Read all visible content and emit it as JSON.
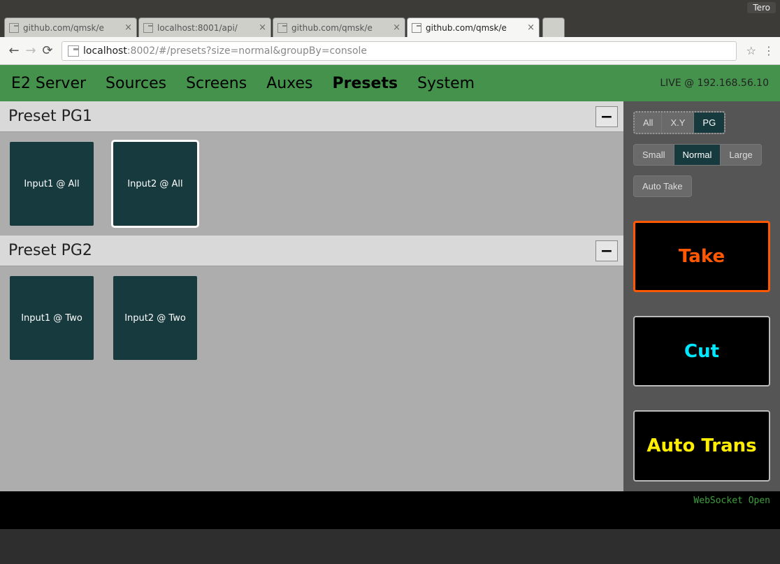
{
  "os": {
    "user": "Tero"
  },
  "browser": {
    "tabs": [
      {
        "label": "github.com/qmsk/e",
        "active": false
      },
      {
        "label": "localhost:8001/api/",
        "active": false
      },
      {
        "label": "github.com/qmsk/e",
        "active": false
      },
      {
        "label": "github.com/qmsk/e",
        "active": true
      }
    ],
    "address": {
      "scheme_host": "localhost",
      "port_path": ":8002/#/presets?size=normal&groupBy=console"
    }
  },
  "nav": {
    "brand": "E2 Server",
    "items": [
      {
        "label": "Sources",
        "active": false
      },
      {
        "label": "Screens",
        "active": false
      },
      {
        "label": "Auxes",
        "active": false
      },
      {
        "label": "Presets",
        "active": true
      },
      {
        "label": "System",
        "active": false
      }
    ],
    "status": "LIVE @ 192.168.56.10"
  },
  "groups": [
    {
      "title": "Preset PG1",
      "presets": [
        {
          "label": "Input1 @ All",
          "selected": false
        },
        {
          "label": "Input2 @ All",
          "selected": true
        }
      ]
    },
    {
      "title": "Preset PG2",
      "presets": [
        {
          "label": "Input1 @ Two",
          "selected": false
        },
        {
          "label": "Input2 @ Two",
          "selected": false
        }
      ]
    }
  ],
  "side": {
    "groupBy": [
      {
        "label": "All",
        "active": false
      },
      {
        "label": "X.Y",
        "active": false
      },
      {
        "label": "PG",
        "active": true
      }
    ],
    "size": [
      {
        "label": "Small",
        "active": false
      },
      {
        "label": "Normal",
        "active": true
      },
      {
        "label": "Large",
        "active": false
      }
    ],
    "autoTake": "Auto Take",
    "take": "Take",
    "cut": "Cut",
    "autoTrans": "Auto Trans"
  },
  "footer": {
    "status": "WebSocket Open"
  }
}
